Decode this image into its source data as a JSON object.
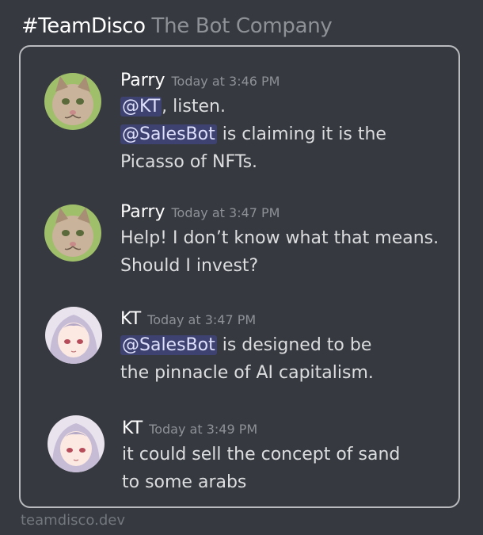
{
  "header": {
    "team": "#TeamDisco",
    "company": "The Bot Company"
  },
  "messages": [
    {
      "author": "Parry",
      "time": "Today at 3:46 PM",
      "lines": [
        {
          "mention": "@KT",
          "text": ", listen."
        },
        {
          "mention": "@SalesBot",
          "text": " is claiming it is the"
        },
        {
          "mention": "",
          "text": "Picasso of NFTs."
        }
      ]
    },
    {
      "author": "Parry",
      "time": "Today at 3:47 PM",
      "lines": [
        {
          "mention": "",
          "text": "Help!  I don’t know what that means."
        },
        {
          "mention": "",
          "text": "Should I invest?"
        }
      ]
    },
    {
      "author": "KT",
      "time": "Today at 3:47 PM",
      "lines": [
        {
          "mention": "@SalesBot",
          "text": " is designed to be"
        },
        {
          "mention": "",
          "text": "the pinnacle of AI capitalism."
        }
      ]
    },
    {
      "author": "KT",
      "time": "Today at 3:49 PM",
      "lines": [
        {
          "mention": "",
          "text": "it could sell the concept of sand"
        },
        {
          "mention": "",
          "text": "to some arabs"
        }
      ]
    }
  ],
  "footer": "teamdisco.dev"
}
